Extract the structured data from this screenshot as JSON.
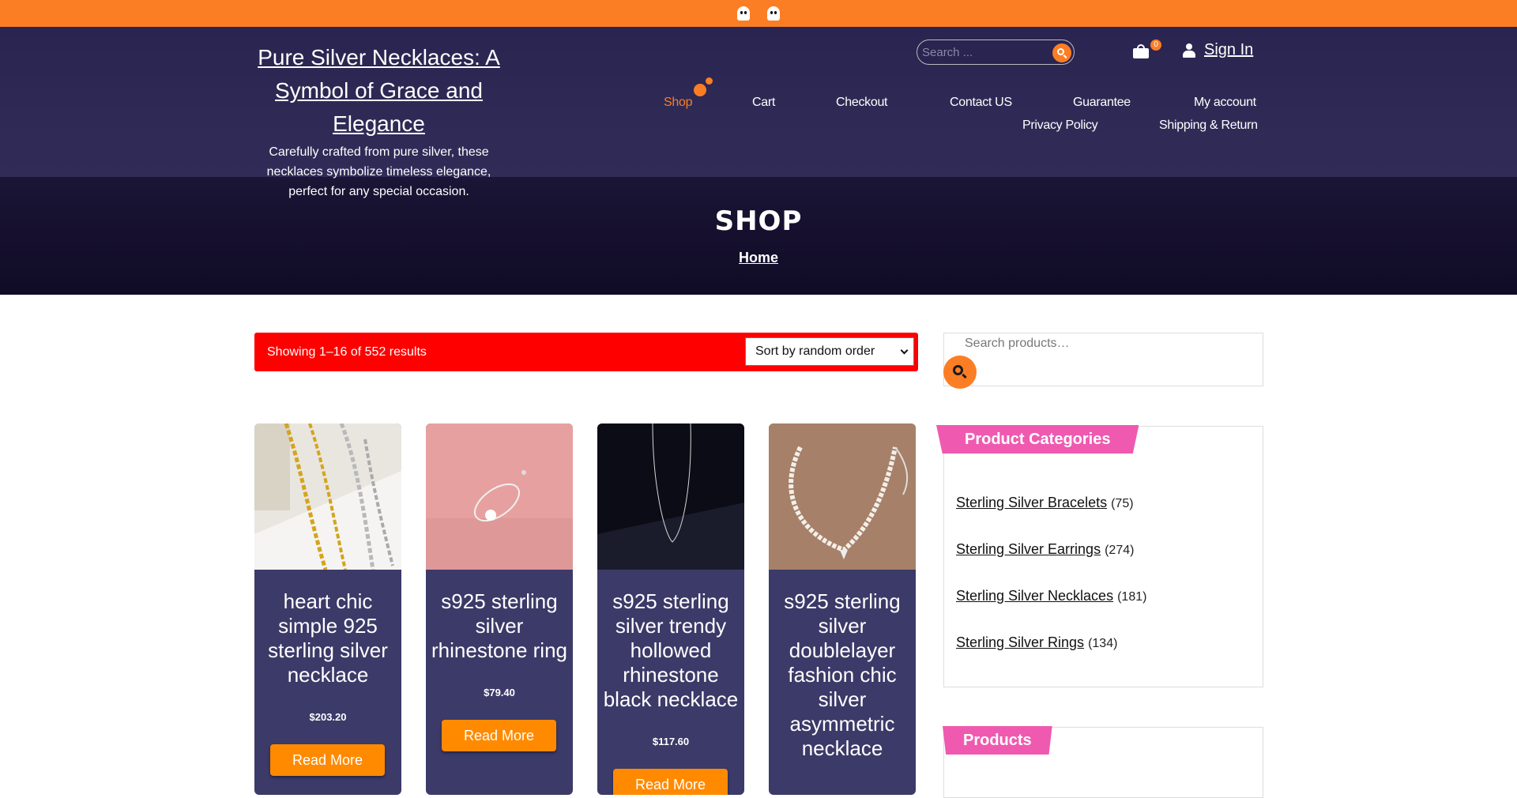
{
  "site": {
    "title": "Pure Silver Necklaces: A Symbol of Grace and Elegance",
    "description": "Carefully crafted from pure silver, these necklaces symbolize timeless elegance, perfect for any special occasion."
  },
  "header": {
    "search_placeholder": "Search ...",
    "cart_count": "0",
    "signin_label": "Sign In"
  },
  "nav": {
    "items": [
      "Shop",
      "Cart",
      "Checkout",
      "Contact US",
      "Guarantee",
      "My account",
      "Privacy Policy",
      "Shipping & Return"
    ]
  },
  "hero": {
    "title": "SHOP",
    "breadcrumb": "Home"
  },
  "shop": {
    "results_text": "Showing 1–16 of 552 results",
    "sort_selected": "Sort by random order"
  },
  "products": [
    {
      "title": "heart chic simple 925 sterling silver necklace",
      "price": "$203.20",
      "button": "Read More"
    },
    {
      "title": "s925 sterling silver rhinestone ring",
      "price": "$79.40",
      "button": "Read More"
    },
    {
      "title": "s925 sterling silver trendy hollowed rhinestone black necklace",
      "price": "$117.60",
      "button": "Read More"
    },
    {
      "title": "s925 sterling silver doublelayer fashion chic silver asymmetric necklace",
      "price": "",
      "button": ""
    }
  ],
  "sidebar": {
    "search_placeholder": "Search products…",
    "categories_title": "Product Categories",
    "categories": [
      {
        "name": "Sterling Silver Bracelets",
        "count": "(75)"
      },
      {
        "name": "Sterling Silver Earrings",
        "count": "(274)"
      },
      {
        "name": "Sterling Silver Necklaces",
        "count": "(181)"
      },
      {
        "name": "Sterling Silver Rings",
        "count": "(134)"
      }
    ],
    "products_title": "Products"
  },
  "colors": {
    "accent_orange": "#fb7e25",
    "header_bg": "#2f2a55",
    "results_bar": "#ff0000",
    "product_card": "#3b3a68",
    "widget_tag": "#ef5ab0"
  },
  "icons": [
    "ghost-icon",
    "search-icon",
    "cart-icon",
    "user-icon"
  ]
}
